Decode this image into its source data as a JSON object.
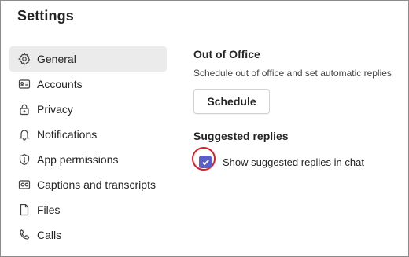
{
  "window": {
    "title": "Settings"
  },
  "nav": {
    "items": [
      {
        "label": "General",
        "icon": "gear-icon",
        "active": true
      },
      {
        "label": "Accounts",
        "icon": "id-card-icon",
        "active": false
      },
      {
        "label": "Privacy",
        "icon": "lock-icon",
        "active": false
      },
      {
        "label": "Notifications",
        "icon": "bell-icon",
        "active": false
      },
      {
        "label": "App permissions",
        "icon": "shield-icon",
        "active": false
      },
      {
        "label": "Captions and transcripts",
        "icon": "closed-captions-icon",
        "active": false
      },
      {
        "label": "Files",
        "icon": "file-icon",
        "active": false
      },
      {
        "label": "Calls",
        "icon": "phone-icon",
        "active": false
      }
    ]
  },
  "out_of_office": {
    "title": "Out of Office",
    "description": "Schedule out of office and set automatic replies",
    "button_label": "Schedule"
  },
  "suggested_replies": {
    "title": "Suggested replies",
    "checkbox_label": "Show suggested replies in chat",
    "checked": true
  },
  "colors": {
    "accent": "#5b5fc7",
    "highlight_ring": "#d81e2b",
    "active_nav_bg": "#ebebeb"
  }
}
